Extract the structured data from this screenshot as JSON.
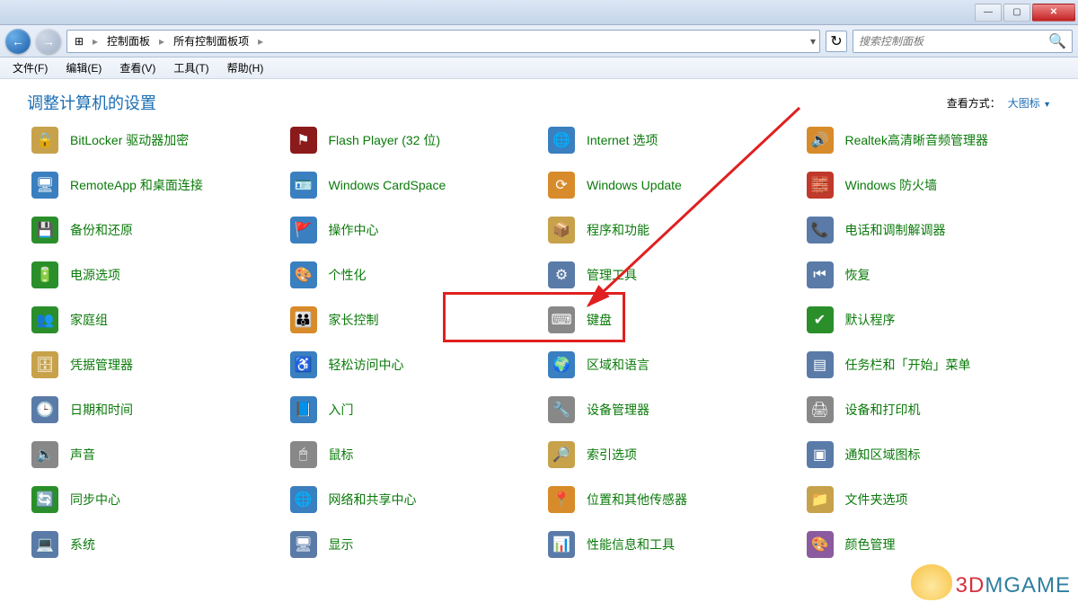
{
  "titlebar": {
    "min": "—",
    "max": "▢",
    "close": "✕"
  },
  "nav": {
    "back": "←",
    "forward": "→"
  },
  "breadcrumb": {
    "root_icon": "▸",
    "panel_icon": "⊞",
    "items": [
      "控制面板",
      "所有控制面板项"
    ],
    "sep": "▸"
  },
  "refresh_icon": "↻",
  "search": {
    "placeholder": "搜索控制面板",
    "icon": "🔍"
  },
  "menus": [
    {
      "label": "文件(F)"
    },
    {
      "label": "编辑(E)"
    },
    {
      "label": "查看(V)"
    },
    {
      "label": "工具(T)"
    },
    {
      "label": "帮助(H)"
    }
  ],
  "header": {
    "title": "调整计算机的设置",
    "view_label": "查看方式：",
    "view_value": "大图标"
  },
  "items": [
    {
      "label": "BitLocker 驱动器加密",
      "icon": "🔒",
      "bg": "#c7a24b"
    },
    {
      "label": "Flash Player (32 位)",
      "icon": "⚑",
      "bg": "#8b1a1a"
    },
    {
      "label": "Internet 选项",
      "icon": "🌐",
      "bg": "#3a7fbf"
    },
    {
      "label": "Realtek高清晰音频管理器",
      "icon": "🔊",
      "bg": "#d88b2a"
    },
    {
      "label": "RemoteApp 和桌面连接",
      "icon": "🖥",
      "bg": "#3a7fbf"
    },
    {
      "label": "Windows CardSpace",
      "icon": "🪪",
      "bg": "#3a7fbf"
    },
    {
      "label": "Windows Update",
      "icon": "⟳",
      "bg": "#d88b2a"
    },
    {
      "label": "Windows 防火墙",
      "icon": "🧱",
      "bg": "#c0392b"
    },
    {
      "label": "备份和还原",
      "icon": "💾",
      "bg": "#2a8f2a"
    },
    {
      "label": "操作中心",
      "icon": "🚩",
      "bg": "#3a7fbf"
    },
    {
      "label": "程序和功能",
      "icon": "📦",
      "bg": "#c7a24b"
    },
    {
      "label": "电话和调制解调器",
      "icon": "📞",
      "bg": "#5a7ba8"
    },
    {
      "label": "电源选项",
      "icon": "🔋",
      "bg": "#2a8f2a"
    },
    {
      "label": "个性化",
      "icon": "🎨",
      "bg": "#3a7fbf"
    },
    {
      "label": "管理工具",
      "icon": "⚙",
      "bg": "#5a7ba8"
    },
    {
      "label": "恢复",
      "icon": "⏮",
      "bg": "#5a7ba8"
    },
    {
      "label": "家庭组",
      "icon": "👥",
      "bg": "#2a8f2a"
    },
    {
      "label": "家长控制",
      "icon": "👪",
      "bg": "#d88b2a"
    },
    {
      "label": "键盘",
      "icon": "⌨",
      "bg": "#888"
    },
    {
      "label": "默认程序",
      "icon": "✔",
      "bg": "#2a8f2a"
    },
    {
      "label": "凭据管理器",
      "icon": "🗄",
      "bg": "#c7a24b"
    },
    {
      "label": "轻松访问中心",
      "icon": "♿",
      "bg": "#3a7fbf"
    },
    {
      "label": "区域和语言",
      "icon": "🌍",
      "bg": "#3a7fbf"
    },
    {
      "label": "任务栏和「开始」菜单",
      "icon": "▤",
      "bg": "#5a7ba8"
    },
    {
      "label": "日期和时间",
      "icon": "🕒",
      "bg": "#5a7ba8"
    },
    {
      "label": "入门",
      "icon": "📘",
      "bg": "#3a7fbf"
    },
    {
      "label": "设备管理器",
      "icon": "🔧",
      "bg": "#888"
    },
    {
      "label": "设备和打印机",
      "icon": "🖨",
      "bg": "#888"
    },
    {
      "label": "声音",
      "icon": "🔈",
      "bg": "#888"
    },
    {
      "label": "鼠标",
      "icon": "🖱",
      "bg": "#888"
    },
    {
      "label": "索引选项",
      "icon": "🔎",
      "bg": "#c7a24b"
    },
    {
      "label": "通知区域图标",
      "icon": "▣",
      "bg": "#5a7ba8"
    },
    {
      "label": "同步中心",
      "icon": "🔄",
      "bg": "#2a8f2a"
    },
    {
      "label": "网络和共享中心",
      "icon": "🌐",
      "bg": "#3a7fbf"
    },
    {
      "label": "位置和其他传感器",
      "icon": "📍",
      "bg": "#d88b2a"
    },
    {
      "label": "文件夹选项",
      "icon": "📁",
      "bg": "#c7a24b"
    },
    {
      "label": "系统",
      "icon": "💻",
      "bg": "#5a7ba8"
    },
    {
      "label": "显示",
      "icon": "🖥",
      "bg": "#5a7ba8"
    },
    {
      "label": "性能信息和工具",
      "icon": "📊",
      "bg": "#5a7ba8"
    },
    {
      "label": "颜色管理",
      "icon": "🎨",
      "bg": "#8b5a9f"
    }
  ],
  "watermark": {
    "d": "3D",
    "rest": "MGAME"
  }
}
